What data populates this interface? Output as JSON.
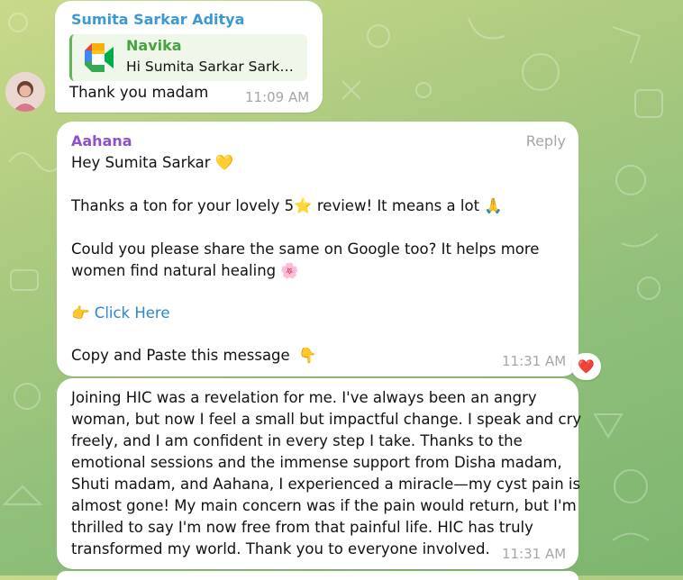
{
  "messages": [
    {
      "sender": "Sumita Sarkar Aditya",
      "sender_color": "#3b9ad4",
      "reply": {
        "name": "Navika",
        "text": "Hi Sumita Sarkar Sark…",
        "icon": "google-meet-icon"
      },
      "text": "Thank you madam",
      "time": "11:09 AM"
    },
    {
      "sender": "Aahana",
      "sender_color": "#8e52c8",
      "reply_button": "Reply",
      "greeting": "Hey Sumita Sarkar",
      "greeting_emoji": "💛",
      "thanks_part1": "Thanks a ton for your lovely 5",
      "thanks_star": "⭐",
      "thanks_part2": " review! It means a lot",
      "thanks_emoji": "🙏",
      "share_line1": "Could you please share the same on Google too? It helps more",
      "share_line2": "women find natural healing",
      "share_emoji": "🌸",
      "link_emoji": "👉",
      "link_label": "Click Here",
      "copy_text": "Copy and Paste this message",
      "copy_emoji": "👇",
      "time": "11:31 AM",
      "reaction": "❤️"
    },
    {
      "lines": [
        "Joining HIC was a revelation for me. I've always been an angry",
        "woman, but now I feel a small but impactful change. I speak and cry",
        "freely, and I am confident in every step I take. Thanks to the",
        "emotional sessions and the immense support from Disha madam,",
        "Shuti madam, and Aahana, I experienced a miracle—my cyst pain is",
        "almost gone! My main concern was if the pain would return, but I'm",
        "thrilled to say I'm now free from that painful life. HIC has truly",
        "transformed my world. Thank you to everyone involved."
      ],
      "time": "11:31 AM"
    }
  ],
  "colors": {
    "link": "#2f88c8",
    "reply_accent": "#5eb85a",
    "timestamp": "#a6a6a6"
  }
}
